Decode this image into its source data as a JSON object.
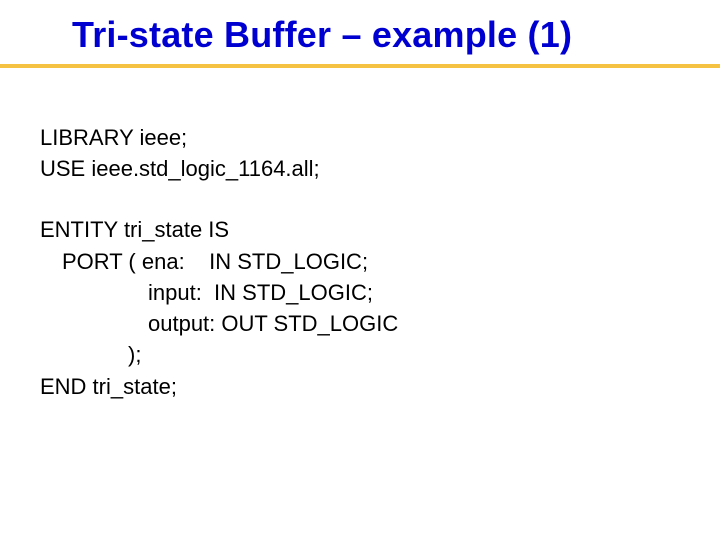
{
  "title": "Tri-state Buffer – example (1)",
  "lib": {
    "l1": "LIBRARY ieee;",
    "l2": "USE ieee.std_logic_1164.all;"
  },
  "entity": {
    "l1": "ENTITY tri_state IS",
    "l2": "PORT ( ena:    IN STD_LOGIC;",
    "l3": "input:  IN STD_LOGIC;",
    "l4": "output: OUT STD_LOGIC",
    "l5": ");",
    "l6": "END tri_state;"
  }
}
